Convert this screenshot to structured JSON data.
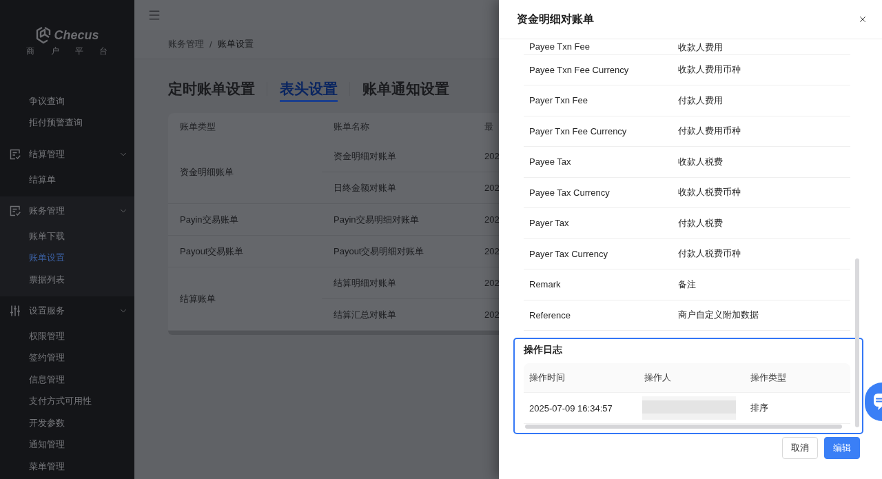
{
  "sidebar": {
    "logo": "Checus",
    "subtitle": "商 户 平 台",
    "items": [
      {
        "kind": "link",
        "label": "争议查询",
        "selected": false
      },
      {
        "kind": "link",
        "label": "拒付预警查询",
        "selected": false
      },
      {
        "kind": "group",
        "label": "结算管理",
        "expanded": true,
        "children": [
          {
            "label": "结算单",
            "selected": false
          }
        ]
      },
      {
        "kind": "group",
        "label": "账务管理",
        "expanded": true,
        "children": [
          {
            "label": "账单下载",
            "selected": false
          },
          {
            "label": "账单设置",
            "selected": true
          },
          {
            "label": "票据列表",
            "selected": false
          }
        ]
      },
      {
        "kind": "group",
        "label": "设置服务",
        "expanded": true,
        "children": [
          {
            "label": "权限管理",
            "selected": false
          },
          {
            "label": "签约管理",
            "selected": false
          },
          {
            "label": "信息管理",
            "selected": false
          },
          {
            "label": "支付方式可用性",
            "selected": false
          },
          {
            "label": "开发参数",
            "selected": false
          },
          {
            "label": "通知管理",
            "selected": false
          },
          {
            "label": "菜单管理",
            "selected": false
          }
        ]
      }
    ]
  },
  "breadcrumb": {
    "items": [
      "账务管理",
      "账单设置"
    ],
    "separator": "/"
  },
  "tabs": [
    {
      "label": "定时账单设置",
      "selected": false
    },
    {
      "label": "表头设置",
      "selected": true
    },
    {
      "label": "账单通知设置",
      "selected": false
    }
  ],
  "bill_table": {
    "columns": [
      "账单类型",
      "账单名称",
      "最"
    ],
    "groups": [
      {
        "type": "资金明细账单",
        "bills": [
          {
            "name": "资金明细对账单",
            "column_3": "202"
          },
          {
            "name": "日终金额对账单",
            "column_3": "202"
          }
        ]
      },
      {
        "type": "Payin交易账单",
        "bills": [
          {
            "name": "Payin交易明细对账单",
            "column_3": "202"
          }
        ]
      },
      {
        "type": "Payout交易账单",
        "bills": [
          {
            "name": "Payout交易明细对账单",
            "column_3": "202"
          }
        ]
      },
      {
        "type": "结算账单",
        "bills": [
          {
            "name": "结算明细对账单",
            "column_3": "202"
          },
          {
            "name": "结算汇总对账单",
            "column_3": "202"
          }
        ]
      }
    ]
  },
  "drawer": {
    "title": "资金明细对账单",
    "fields": [
      {
        "name": "Payee Txn Fee",
        "label": "收款人费用"
      },
      {
        "name": "Payee Txn Fee Currency",
        "label": "收款人费用币种"
      },
      {
        "name": "Payer Txn Fee",
        "label": "付款人费用"
      },
      {
        "name": "Payer Txn Fee Currency",
        "label": "付款人费用币种"
      },
      {
        "name": "Payee Tax",
        "label": "收款人税费"
      },
      {
        "name": "Payee Tax Currency",
        "label": "收款人税费币种"
      },
      {
        "name": "Payer Tax",
        "label": "付款人税费"
      },
      {
        "name": "Payer Tax Currency",
        "label": "付款人税费币种"
      },
      {
        "name": "Remark",
        "label": "备注"
      },
      {
        "name": "Reference",
        "label": "商户自定义附加数据"
      }
    ],
    "log": {
      "title": "操作日志",
      "highlighted": true,
      "columns": [
        "操作时间",
        "操作人",
        "操作类型"
      ],
      "rows": [
        {
          "time": "2025-07-09 16:34:57",
          "operator_redacted": true,
          "type": "排序"
        }
      ]
    },
    "buttons": [
      {
        "label": "取消",
        "kind": "default"
      },
      {
        "label": "编辑",
        "kind": "primary"
      }
    ]
  }
}
